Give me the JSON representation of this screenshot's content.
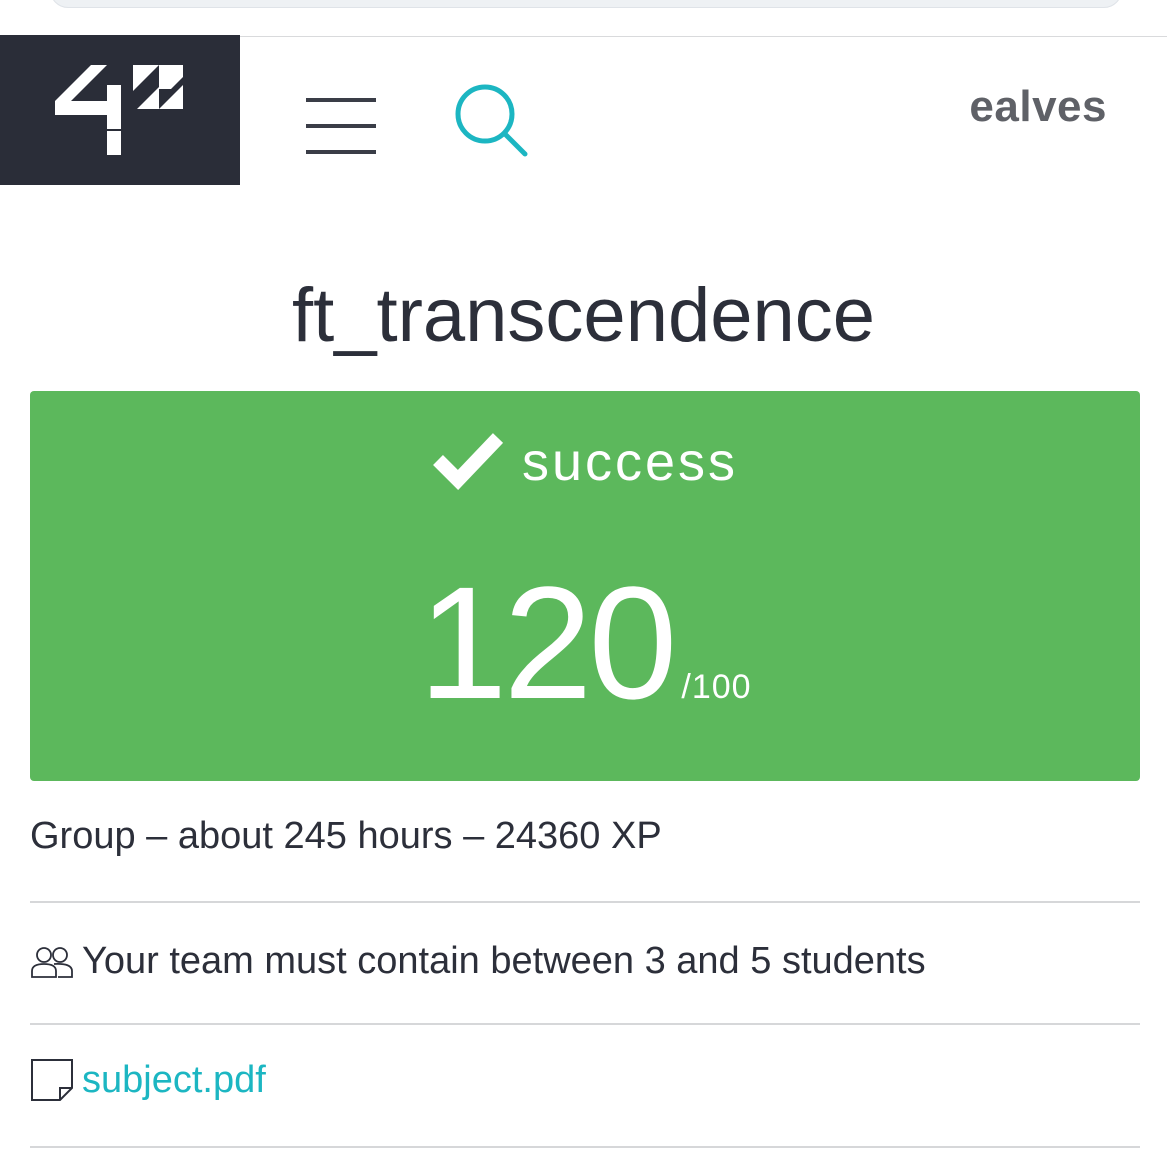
{
  "header": {
    "logo_text": "42",
    "username": "ealves"
  },
  "project": {
    "title": "ft_transcendence",
    "status": "success",
    "score": "120",
    "score_max": "/100"
  },
  "details": {
    "summary": "Group – about 245 hours – 24360 XP",
    "team_requirement": "Your team must contain between 3 and 5 students",
    "attachment": "subject.pdf"
  },
  "colors": {
    "success_green": "#5cb85c",
    "logo_bg": "#2a2d38",
    "accent_teal": "#1cb6c2"
  }
}
